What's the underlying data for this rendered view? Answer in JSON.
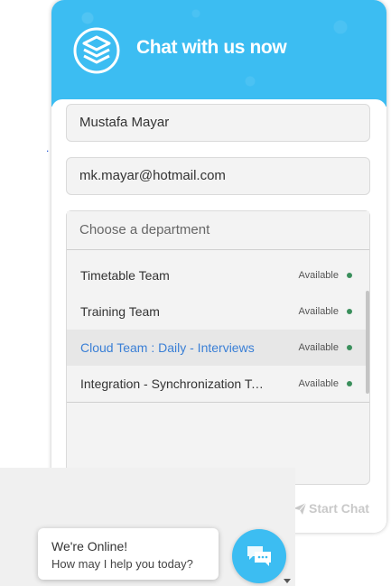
{
  "header": {
    "title": "Chat with us now",
    "logo_icon": "stacked-layers-logo"
  },
  "form": {
    "name_value": "Mustafa Mayar",
    "email_value": "mk.mayar@hotmail.com",
    "department": {
      "placeholder": "Choose a department",
      "options": [
        {
          "label": "Timetable Team",
          "status": "Available"
        },
        {
          "label": "Training Team",
          "status": "Available"
        },
        {
          "label": "Cloud Team : Daily - Interviews",
          "status": "Available"
        },
        {
          "label": "Integration - Synchronization Team",
          "status": "Available"
        }
      ],
      "highlighted_index": 2
    },
    "start_chat_label": "Start Chat"
  },
  "launcher": {
    "line1": "We're Online!",
    "line2": "How may I help you today?"
  },
  "colors": {
    "accent": "#3cbdf2",
    "link": "#3a7fd6",
    "available": "#3a8f5c"
  }
}
